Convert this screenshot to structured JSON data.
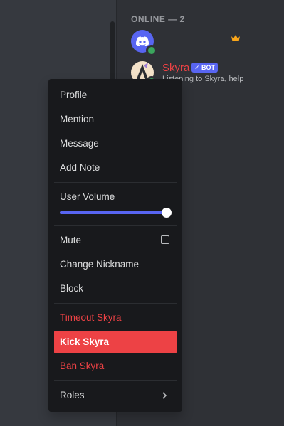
{
  "member_list": {
    "section_header": "ONLINE — 2",
    "members": [
      {
        "name": "",
        "avatar_icon": "discord-logo-icon",
        "badge_icon": "crown-icon",
        "status": "online"
      },
      {
        "name": "Skyra",
        "bot_badge": "✓ BOT",
        "activity": "Listening to Skyra, help",
        "status": "online"
      }
    ]
  },
  "context_menu": {
    "profile": "Profile",
    "mention": "Mention",
    "message": "Message",
    "add_note": "Add Note",
    "user_volume": "User Volume",
    "user_volume_level": 1.0,
    "mute": "Mute",
    "mute_checked": false,
    "change_nickname": "Change Nickname",
    "block": "Block",
    "timeout": "Timeout Skyra",
    "kick": "Kick Skyra",
    "ban": "Ban Skyra",
    "roles": "Roles"
  },
  "colors": {
    "danger": "#ed4245",
    "accent": "#5865f2",
    "online": "#3ba55d",
    "menu_bg": "#18191c"
  }
}
